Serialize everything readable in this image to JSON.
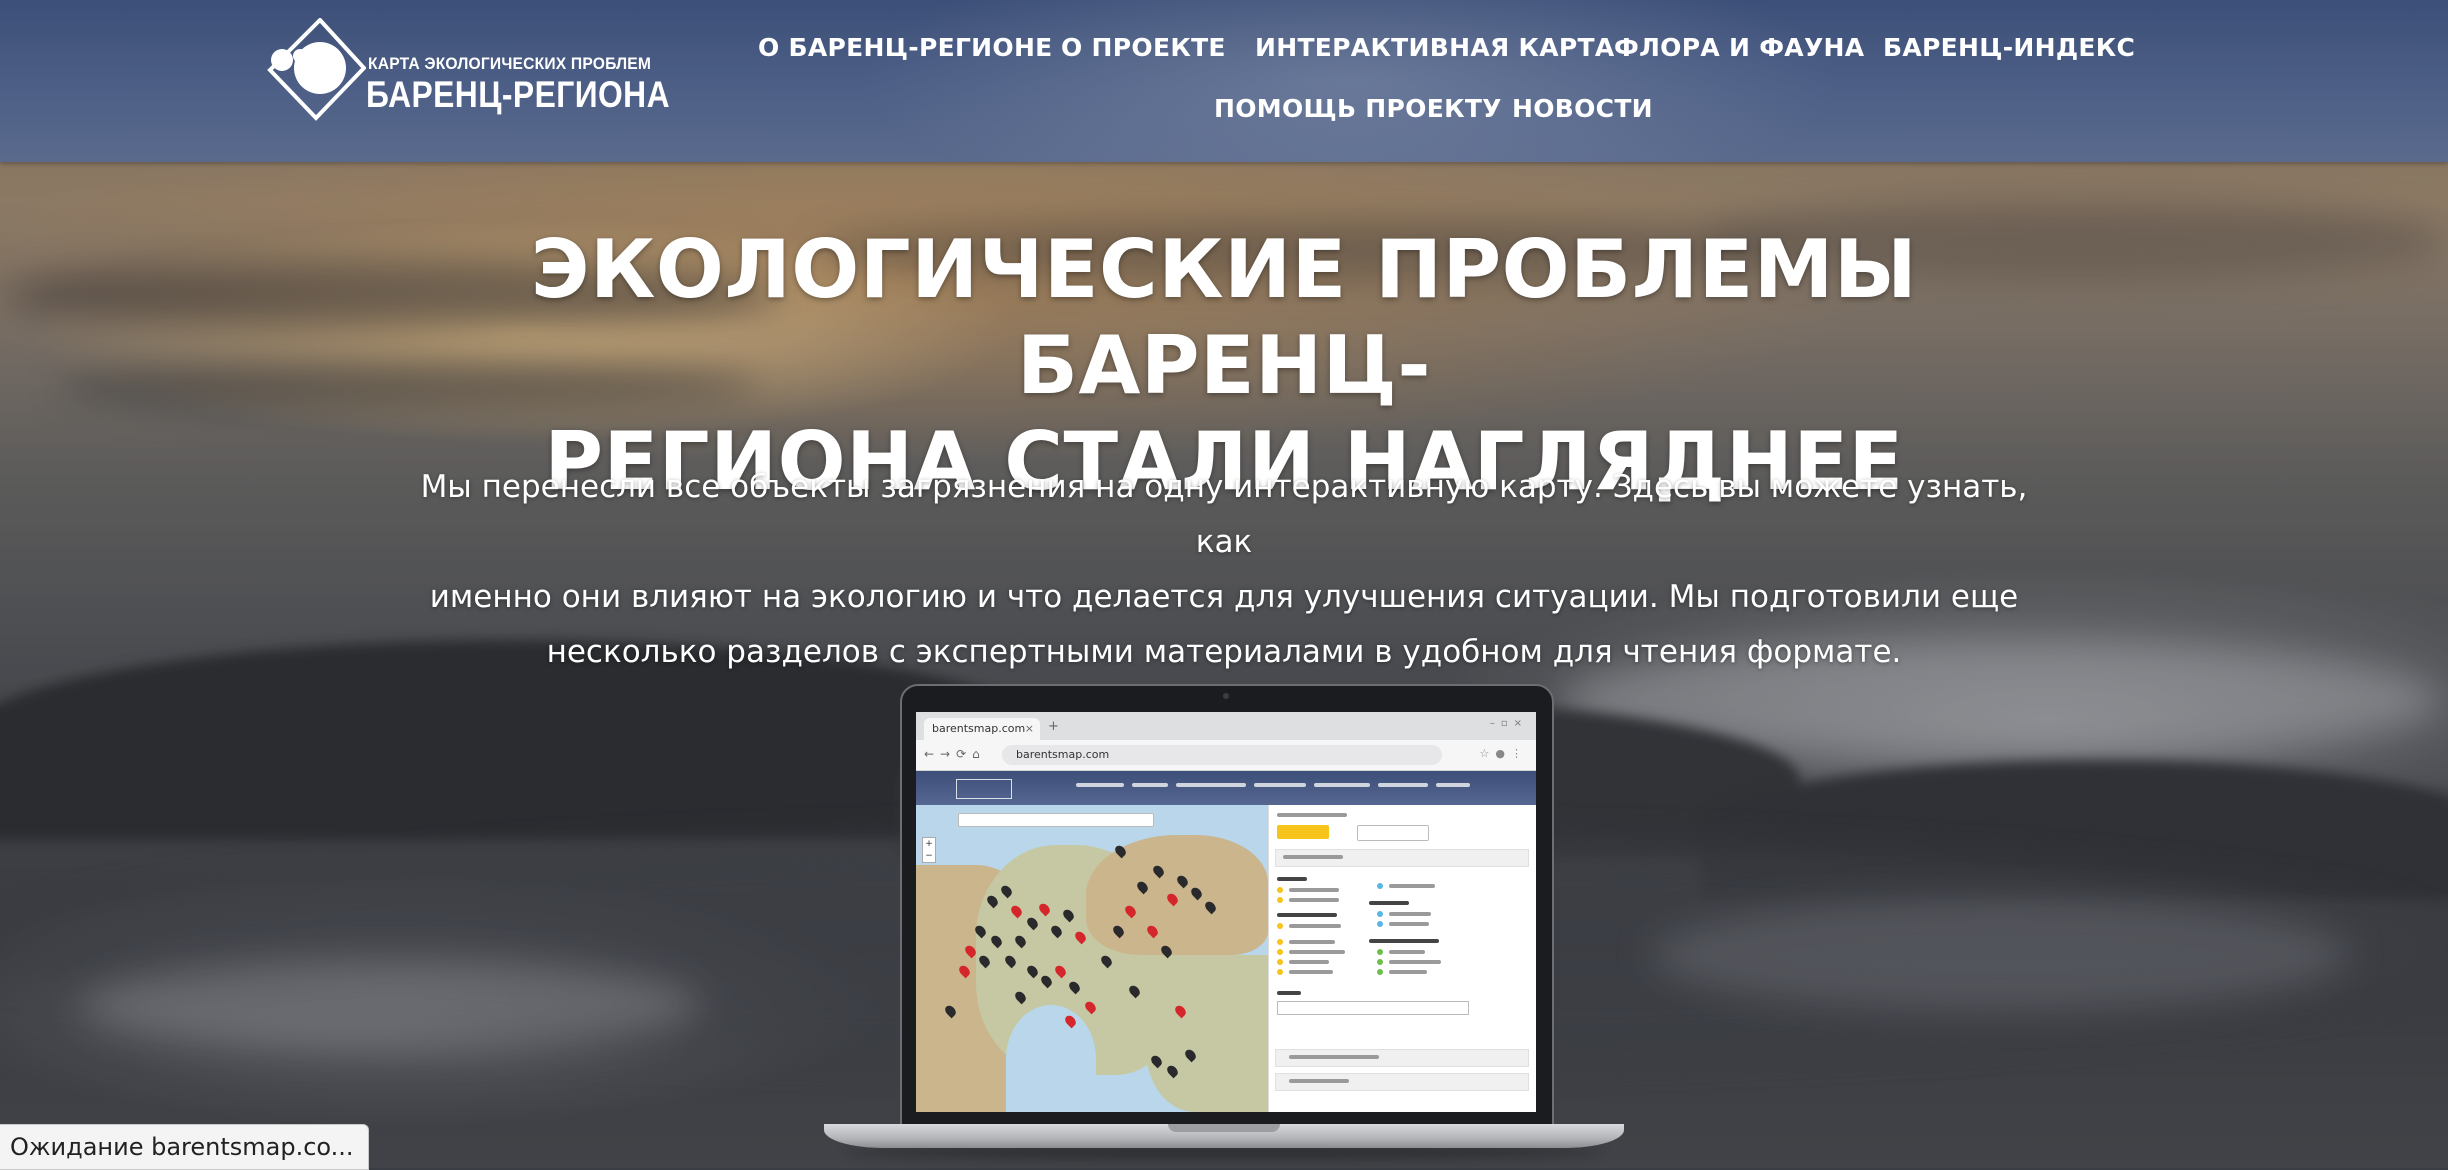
{
  "logo": {
    "line1": "КАРТА ЭКОЛОГИЧЕСКИХ ПРОБЛЕМ",
    "line2": "БАРЕНЦ-РЕГИОНА"
  },
  "nav": {
    "items": [
      "О БАРЕНЦ-РЕГИОНЕ",
      "О ПРОЕКТЕ",
      "ИНТЕРАКТИВНАЯ КАРТА",
      "ФЛОРА И ФАУНА",
      "БАРЕНЦ-ИНДЕКС",
      "ПОМОЩЬ ПРОЕКТУ",
      "НОВОСТИ"
    ]
  },
  "hero": {
    "title_line1": "ЭКОЛОГИЧЕСКИЕ ПРОБЛЕМЫ БАРЕНЦ-",
    "title_line2": "РЕГИОНА СТАЛИ НАГЛЯДНЕЕ",
    "text_line1": "Мы перенесли все объекты загрязнения на одну интерактивную карту. Здесь вы можете узнать, как",
    "text_line2": "именно они влияют на экологию и что делается для улучшения ситуации. Мы подготовили еще",
    "text_line3": "несколько разделов с экспертными материалами в удобном для чтения формате."
  },
  "laptop_browser": {
    "tab_title": "barentsmap.com",
    "url": "barentsmap.com"
  },
  "status_bar": {
    "text": "Ожидание barentsmap.co..."
  },
  "colors": {
    "header_top": "#3c4f78",
    "header_bottom": "#5a6a8d",
    "accent_yellow": "#f6c41b",
    "pin_red": "#d5262c"
  },
  "icons": {
    "logo": "globe-rhombus-logo-icon",
    "laptop": "laptop-mockup-icon"
  }
}
